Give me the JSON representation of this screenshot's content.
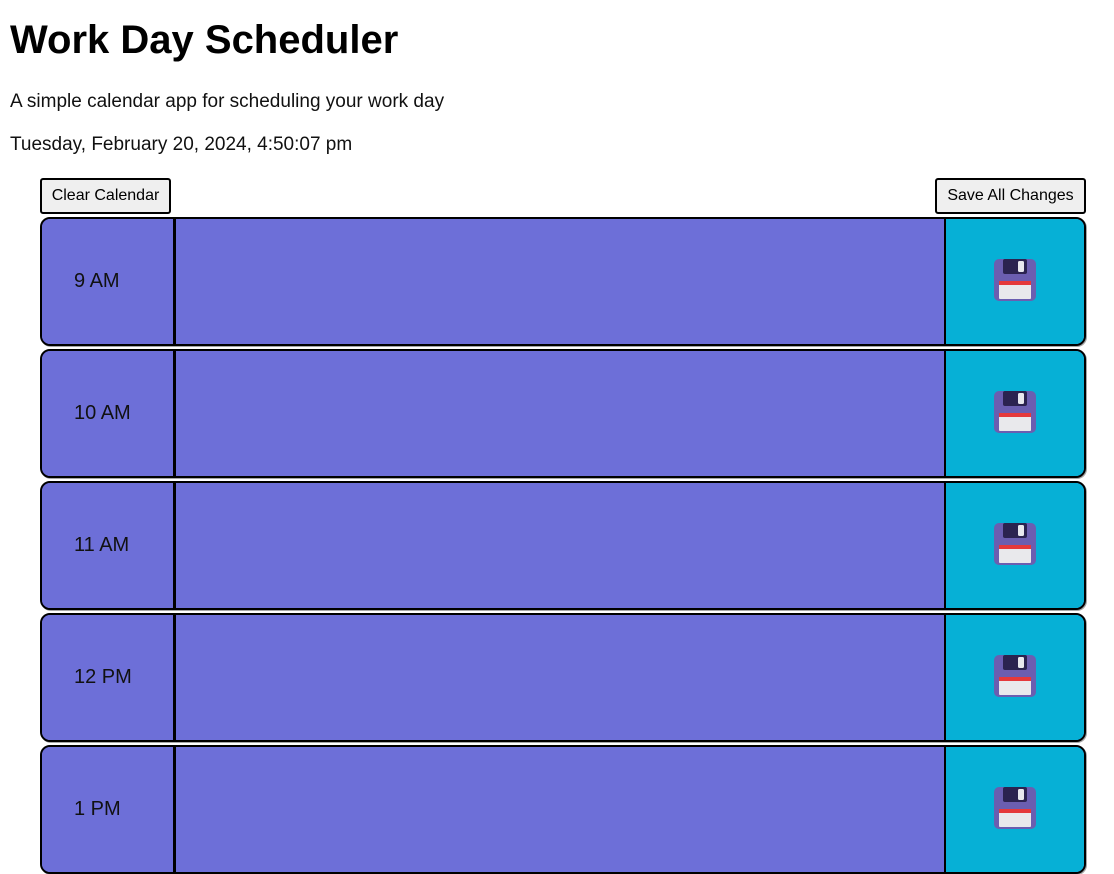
{
  "header": {
    "title": "Work Day Scheduler",
    "subtitle": "A simple calendar app for scheduling your work day",
    "current_datetime": "Tuesday, February 20, 2024, 4:50:07 pm"
  },
  "toolbar": {
    "clear_label": "Clear Calendar",
    "save_all_label": "Save All Changes"
  },
  "schedule": {
    "rows": [
      {
        "hour": "9 AM",
        "description": "",
        "save_icon": "floppy-disk-icon"
      },
      {
        "hour": "10 AM",
        "description": "",
        "save_icon": "floppy-disk-icon"
      },
      {
        "hour": "11 AM",
        "description": "",
        "save_icon": "floppy-disk-icon"
      },
      {
        "hour": "12 PM",
        "description": "",
        "save_icon": "floppy-disk-icon"
      },
      {
        "hour": "1 PM",
        "description": "",
        "save_icon": "floppy-disk-icon"
      }
    ]
  },
  "colors": {
    "row_background": "#6d6fd8",
    "save_button_background": "#06b0d6",
    "border": "#000000"
  }
}
